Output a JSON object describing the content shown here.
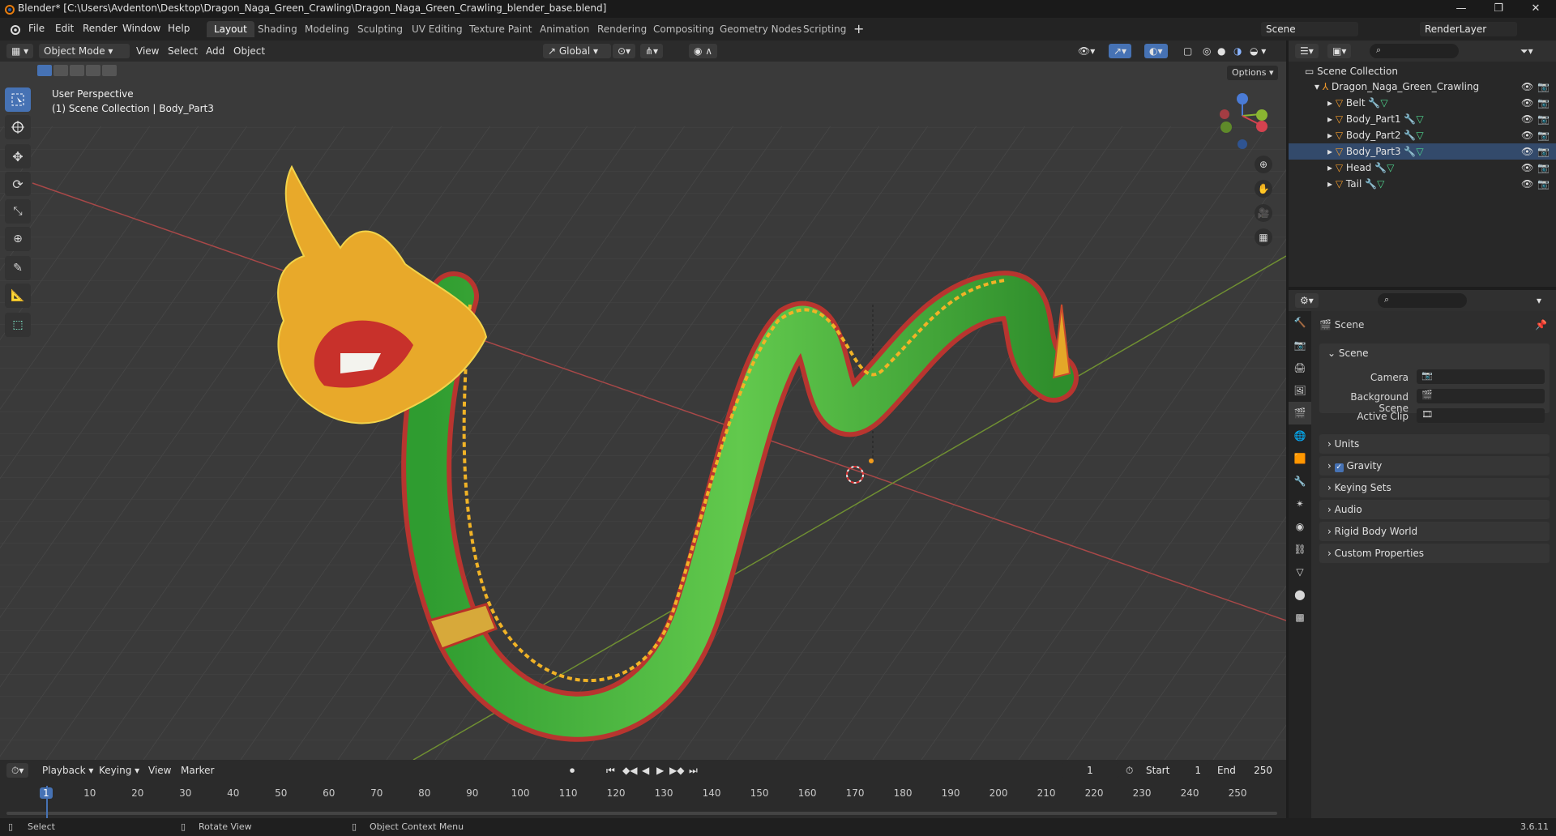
{
  "titlebar": {
    "title": "Blender* [C:\\Users\\Avdenton\\Desktop\\Dragon_Naga_Green_Crawling\\Dragon_Naga_Green_Crawling_blender_base.blend]"
  },
  "menus": [
    "File",
    "Edit",
    "Render",
    "Window",
    "Help"
  ],
  "workspaces": [
    "Layout",
    "Shading",
    "Modeling",
    "Sculpting",
    "UV Editing",
    "Texture Paint",
    "Animation",
    "Rendering",
    "Compositing",
    "Geometry Nodes",
    "Scripting"
  ],
  "scene_field": "Scene",
  "renderlayer_field": "RenderLayer",
  "viewport_header": {
    "mode": "Object Mode",
    "menus": [
      "View",
      "Select",
      "Add",
      "Object"
    ],
    "orientation": "Global",
    "options": "Options"
  },
  "viewport": {
    "perspective": "User Perspective",
    "collection_info": "(1) Scene Collection | Body_Part3"
  },
  "outliner": {
    "root": "Scene Collection",
    "collection": "Dragon_Naga_Green_Crawling",
    "items": [
      "Belt",
      "Body_Part1",
      "Body_Part2",
      "Body_Part3",
      "Head",
      "Tail"
    ]
  },
  "properties": {
    "context": "Scene",
    "panel": "Scene",
    "camera_label": "Camera",
    "background_label": "Background Scene",
    "clip_label": "Active Clip",
    "sections": [
      "Units",
      "Gravity",
      "Keying Sets",
      "Audio",
      "Rigid Body World",
      "Custom Properties"
    ]
  },
  "timeline": {
    "menus": [
      "Playback",
      "Keying",
      "View",
      "Marker"
    ],
    "current_frame": "1",
    "start_label": "Start",
    "start": "1",
    "end_label": "End",
    "end": "250",
    "ticks": [
      "1",
      "10",
      "20",
      "30",
      "40",
      "50",
      "60",
      "70",
      "80",
      "90",
      "100",
      "110",
      "120",
      "130",
      "140",
      "150",
      "160",
      "170",
      "180",
      "190",
      "200",
      "210",
      "220",
      "230",
      "240",
      "250"
    ]
  },
  "statusbar": {
    "select": "Select",
    "rotate": "Rotate View",
    "context_menu": "Object Context Menu",
    "version": "3.6.11"
  }
}
